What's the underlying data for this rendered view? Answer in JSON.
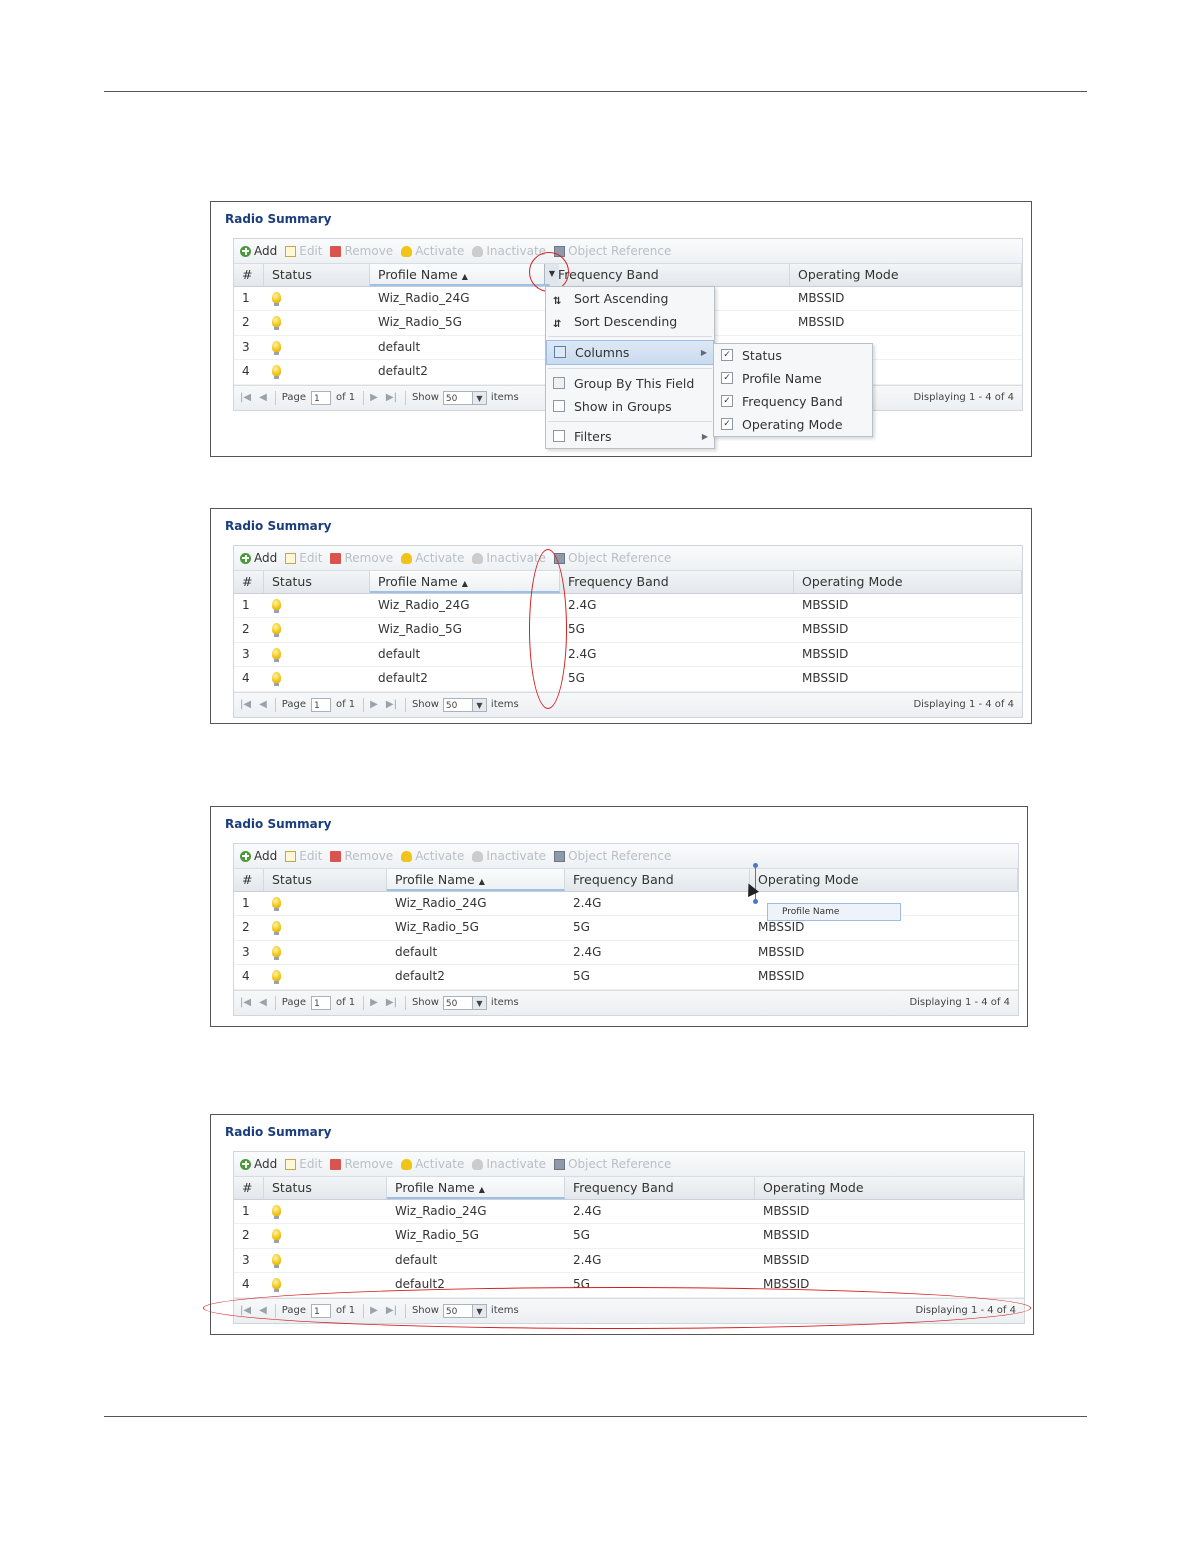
{
  "title": "Radio Summary",
  "toolbar": {
    "add": "Add",
    "edit": "Edit",
    "remove": "Remove",
    "activate": "Activate",
    "inactivate": "Inactivate",
    "object_reference": "Object Reference"
  },
  "columns": {
    "num": "#",
    "status": "Status",
    "profile_name": "Profile Name",
    "frequency_band": "Frequency Band",
    "operating_mode": "Operating Mode"
  },
  "rows": [
    {
      "num": "1",
      "profile": "Wiz_Radio_24G",
      "band": "2.4G",
      "mode": "MBSSID"
    },
    {
      "num": "2",
      "profile": "Wiz_Radio_5G",
      "band": "5G",
      "mode": "MBSSID"
    },
    {
      "num": "3",
      "profile": "default",
      "band": "2.4G",
      "mode": "MBSSID"
    },
    {
      "num": "4",
      "profile": "default2",
      "band": "5G",
      "mode": "MBSSID"
    }
  ],
  "pager": {
    "page_label": "Page",
    "page_value": "1",
    "of_label": "of 1",
    "show_label": "Show",
    "show_value": "50",
    "items_label": "items",
    "display_text": "Displaying 1 - 4 of 4"
  },
  "menu": {
    "sort_ascending": "Sort Ascending",
    "sort_descending": "Sort Descending",
    "columns": "Columns",
    "group_by": "Group By This Field",
    "show_in_groups": "Show in Groups",
    "filters": "Filters"
  },
  "submenu": {
    "status": "Status",
    "profile_name": "Profile Name",
    "frequency_band": "Frequency Band",
    "operating_mode": "Operating Mode"
  },
  "drag_tooltip": "Profile Name",
  "colors": {
    "title_blue": "#1a3d7c",
    "annotation_red": "#d42020"
  }
}
